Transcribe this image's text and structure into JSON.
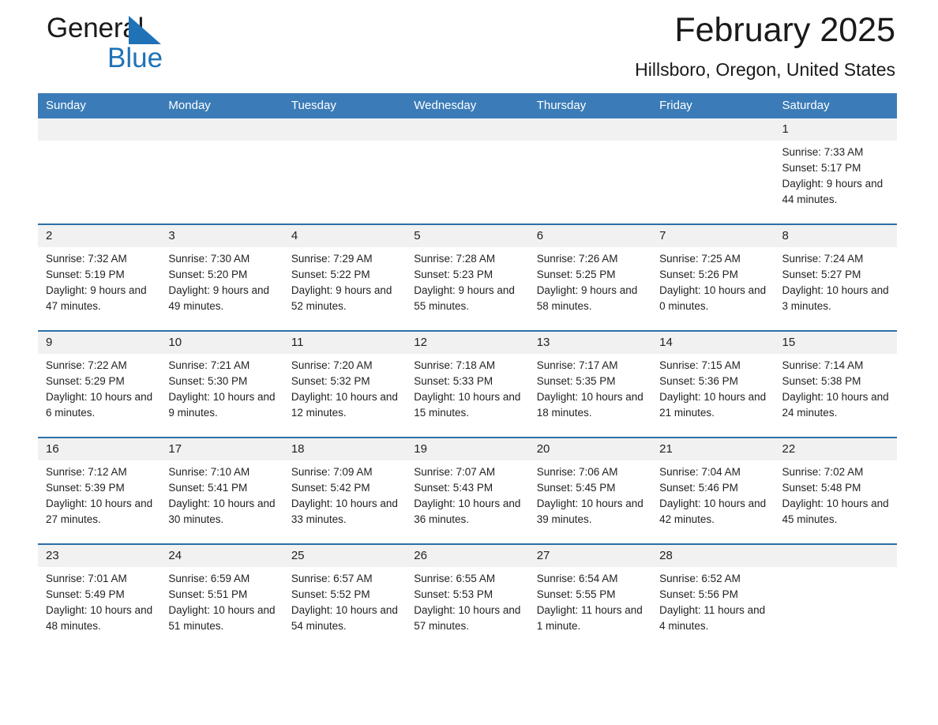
{
  "brand": {
    "name_dark": "General",
    "name_blue": "Blue",
    "accent_color": "#1f72b6"
  },
  "header": {
    "title": "February 2025",
    "subtitle": "Hillsboro, Oregon, United States"
  },
  "calendar": {
    "header_bg": "#3b7cb8",
    "daynum_bg": "#f1f1f1",
    "row_divider_color": "#2d6fa8",
    "weekdays": [
      "Sunday",
      "Monday",
      "Tuesday",
      "Wednesday",
      "Thursday",
      "Friday",
      "Saturday"
    ],
    "weeks": [
      [
        null,
        null,
        null,
        null,
        null,
        null,
        {
          "day": "1",
          "sunrise": "Sunrise: 7:33 AM",
          "sunset": "Sunset: 5:17 PM",
          "daylight": "Daylight: 9 hours and 44 minutes."
        }
      ],
      [
        {
          "day": "2",
          "sunrise": "Sunrise: 7:32 AM",
          "sunset": "Sunset: 5:19 PM",
          "daylight": "Daylight: 9 hours and 47 minutes."
        },
        {
          "day": "3",
          "sunrise": "Sunrise: 7:30 AM",
          "sunset": "Sunset: 5:20 PM",
          "daylight": "Daylight: 9 hours and 49 minutes."
        },
        {
          "day": "4",
          "sunrise": "Sunrise: 7:29 AM",
          "sunset": "Sunset: 5:22 PM",
          "daylight": "Daylight: 9 hours and 52 minutes."
        },
        {
          "day": "5",
          "sunrise": "Sunrise: 7:28 AM",
          "sunset": "Sunset: 5:23 PM",
          "daylight": "Daylight: 9 hours and 55 minutes."
        },
        {
          "day": "6",
          "sunrise": "Sunrise: 7:26 AM",
          "sunset": "Sunset: 5:25 PM",
          "daylight": "Daylight: 9 hours and 58 minutes."
        },
        {
          "day": "7",
          "sunrise": "Sunrise: 7:25 AM",
          "sunset": "Sunset: 5:26 PM",
          "daylight": "Daylight: 10 hours and 0 minutes."
        },
        {
          "day": "8",
          "sunrise": "Sunrise: 7:24 AM",
          "sunset": "Sunset: 5:27 PM",
          "daylight": "Daylight: 10 hours and 3 minutes."
        }
      ],
      [
        {
          "day": "9",
          "sunrise": "Sunrise: 7:22 AM",
          "sunset": "Sunset: 5:29 PM",
          "daylight": "Daylight: 10 hours and 6 minutes."
        },
        {
          "day": "10",
          "sunrise": "Sunrise: 7:21 AM",
          "sunset": "Sunset: 5:30 PM",
          "daylight": "Daylight: 10 hours and 9 minutes."
        },
        {
          "day": "11",
          "sunrise": "Sunrise: 7:20 AM",
          "sunset": "Sunset: 5:32 PM",
          "daylight": "Daylight: 10 hours and 12 minutes."
        },
        {
          "day": "12",
          "sunrise": "Sunrise: 7:18 AM",
          "sunset": "Sunset: 5:33 PM",
          "daylight": "Daylight: 10 hours and 15 minutes."
        },
        {
          "day": "13",
          "sunrise": "Sunrise: 7:17 AM",
          "sunset": "Sunset: 5:35 PM",
          "daylight": "Daylight: 10 hours and 18 minutes."
        },
        {
          "day": "14",
          "sunrise": "Sunrise: 7:15 AM",
          "sunset": "Sunset: 5:36 PM",
          "daylight": "Daylight: 10 hours and 21 minutes."
        },
        {
          "day": "15",
          "sunrise": "Sunrise: 7:14 AM",
          "sunset": "Sunset: 5:38 PM",
          "daylight": "Daylight: 10 hours and 24 minutes."
        }
      ],
      [
        {
          "day": "16",
          "sunrise": "Sunrise: 7:12 AM",
          "sunset": "Sunset: 5:39 PM",
          "daylight": "Daylight: 10 hours and 27 minutes."
        },
        {
          "day": "17",
          "sunrise": "Sunrise: 7:10 AM",
          "sunset": "Sunset: 5:41 PM",
          "daylight": "Daylight: 10 hours and 30 minutes."
        },
        {
          "day": "18",
          "sunrise": "Sunrise: 7:09 AM",
          "sunset": "Sunset: 5:42 PM",
          "daylight": "Daylight: 10 hours and 33 minutes."
        },
        {
          "day": "19",
          "sunrise": "Sunrise: 7:07 AM",
          "sunset": "Sunset: 5:43 PM",
          "daylight": "Daylight: 10 hours and 36 minutes."
        },
        {
          "day": "20",
          "sunrise": "Sunrise: 7:06 AM",
          "sunset": "Sunset: 5:45 PM",
          "daylight": "Daylight: 10 hours and 39 minutes."
        },
        {
          "day": "21",
          "sunrise": "Sunrise: 7:04 AM",
          "sunset": "Sunset: 5:46 PM",
          "daylight": "Daylight: 10 hours and 42 minutes."
        },
        {
          "day": "22",
          "sunrise": "Sunrise: 7:02 AM",
          "sunset": "Sunset: 5:48 PM",
          "daylight": "Daylight: 10 hours and 45 minutes."
        }
      ],
      [
        {
          "day": "23",
          "sunrise": "Sunrise: 7:01 AM",
          "sunset": "Sunset: 5:49 PM",
          "daylight": "Daylight: 10 hours and 48 minutes."
        },
        {
          "day": "24",
          "sunrise": "Sunrise: 6:59 AM",
          "sunset": "Sunset: 5:51 PM",
          "daylight": "Daylight: 10 hours and 51 minutes."
        },
        {
          "day": "25",
          "sunrise": "Sunrise: 6:57 AM",
          "sunset": "Sunset: 5:52 PM",
          "daylight": "Daylight: 10 hours and 54 minutes."
        },
        {
          "day": "26",
          "sunrise": "Sunrise: 6:55 AM",
          "sunset": "Sunset: 5:53 PM",
          "daylight": "Daylight: 10 hours and 57 minutes."
        },
        {
          "day": "27",
          "sunrise": "Sunrise: 6:54 AM",
          "sunset": "Sunset: 5:55 PM",
          "daylight": "Daylight: 11 hours and 1 minute."
        },
        {
          "day": "28",
          "sunrise": "Sunrise: 6:52 AM",
          "sunset": "Sunset: 5:56 PM",
          "daylight": "Daylight: 11 hours and 4 minutes."
        },
        null
      ]
    ]
  }
}
